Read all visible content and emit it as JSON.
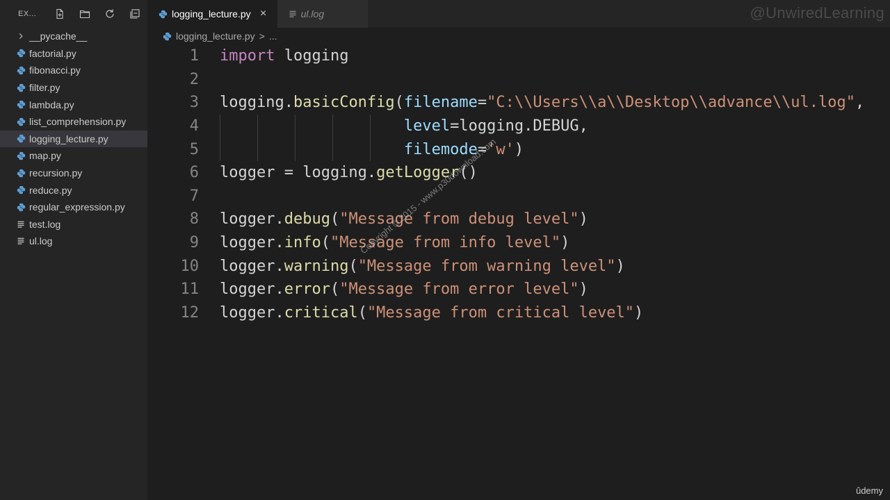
{
  "explorer": {
    "title": "EX...",
    "actions": [
      {
        "name": "new-file",
        "icon": "new-file-icon"
      },
      {
        "name": "new-folder",
        "icon": "new-folder-icon"
      },
      {
        "name": "refresh",
        "icon": "refresh-icon"
      },
      {
        "name": "collapse-all",
        "icon": "collapse-all-icon"
      }
    ],
    "items": [
      {
        "label": "__pycache__",
        "type": "folder"
      },
      {
        "label": "factorial.py",
        "type": "py"
      },
      {
        "label": "fibonacci.py",
        "type": "py"
      },
      {
        "label": "filter.py",
        "type": "py"
      },
      {
        "label": "lambda.py",
        "type": "py"
      },
      {
        "label": "list_comprehension.py",
        "type": "py"
      },
      {
        "label": "logging_lecture.py",
        "type": "py",
        "selected": true
      },
      {
        "label": "map.py",
        "type": "py"
      },
      {
        "label": "recursion.py",
        "type": "py"
      },
      {
        "label": "reduce.py",
        "type": "py"
      },
      {
        "label": "regular_expression.py",
        "type": "py"
      },
      {
        "label": "test.log",
        "type": "log"
      },
      {
        "label": "ul.log",
        "type": "log"
      }
    ]
  },
  "tabs": [
    {
      "label": "logging_lecture.py",
      "active": true,
      "close": "×"
    },
    {
      "label": "ul.log",
      "active": false
    }
  ],
  "brand_watermark": "@UnwiredLearning",
  "breadcrumb": {
    "file": "logging_lecture.py",
    "separator": ">",
    "more": "..."
  },
  "code_lines": [
    {
      "n": "1",
      "tokens": [
        [
          "kw",
          "import"
        ],
        [
          "plain",
          " logging"
        ]
      ]
    },
    {
      "n": "2",
      "tokens": []
    },
    {
      "n": "3",
      "tokens": [
        [
          "plain",
          "logging."
        ],
        [
          "fn",
          "basicConfig"
        ],
        [
          "plain",
          "("
        ],
        [
          "var",
          "filename"
        ],
        [
          "plain",
          "="
        ],
        [
          "str",
          "\"C:\\\\Users\\\\a\\\\Desktop\\\\advance\\\\ul.log\""
        ],
        [
          "plain",
          ","
        ]
      ]
    },
    {
      "n": "4",
      "tokens": [
        [
          "plain",
          "                    "
        ],
        [
          "var",
          "level"
        ],
        [
          "plain",
          "=logging.DEBUG,"
        ]
      ]
    },
    {
      "n": "5",
      "tokens": [
        [
          "plain",
          "                    "
        ],
        [
          "var",
          "filemode"
        ],
        [
          "plain",
          "="
        ],
        [
          "str",
          "'w'"
        ],
        [
          "plain",
          ")"
        ]
      ]
    },
    {
      "n": "6",
      "tokens": [
        [
          "plain",
          "logger = logging."
        ],
        [
          "fn",
          "getLogger"
        ],
        [
          "plain",
          "()"
        ]
      ]
    },
    {
      "n": "7",
      "tokens": []
    },
    {
      "n": "8",
      "tokens": [
        [
          "plain",
          "logger."
        ],
        [
          "fn",
          "debug"
        ],
        [
          "plain",
          "("
        ],
        [
          "str",
          "\"Message from debug level\""
        ],
        [
          "plain",
          ")"
        ]
      ]
    },
    {
      "n": "9",
      "tokens": [
        [
          "plain",
          "logger."
        ],
        [
          "fn",
          "info"
        ],
        [
          "plain",
          "("
        ],
        [
          "str",
          "\"Message from info level\""
        ],
        [
          "plain",
          ")"
        ]
      ]
    },
    {
      "n": "10",
      "tokens": [
        [
          "plain",
          "logger."
        ],
        [
          "fn",
          "warning"
        ],
        [
          "plain",
          "("
        ],
        [
          "str",
          "\"Message from warning level\""
        ],
        [
          "plain",
          ")"
        ]
      ]
    },
    {
      "n": "11",
      "tokens": [
        [
          "plain",
          "logger."
        ],
        [
          "fn",
          "error"
        ],
        [
          "plain",
          "("
        ],
        [
          "str",
          "\"Message from error level\""
        ],
        [
          "plain",
          ")"
        ]
      ]
    },
    {
      "n": "12",
      "tokens": [
        [
          "plain",
          "logger."
        ],
        [
          "fn",
          "critical"
        ],
        [
          "plain",
          "("
        ],
        [
          "str",
          "\"Message from critical level\""
        ],
        [
          "plain",
          ")"
        ]
      ]
    }
  ],
  "overlay_watermark": "Copyright © 2015 - www.p30download.com",
  "udemy_logo": "ûdemy"
}
